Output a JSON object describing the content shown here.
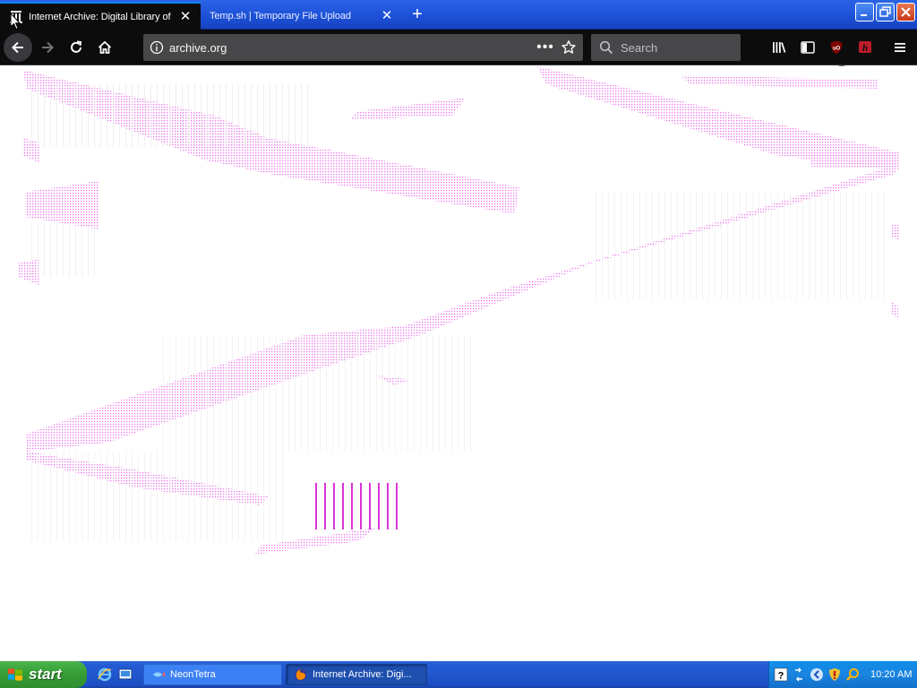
{
  "window": {
    "tabs": [
      {
        "title": "Internet Archive: Digital Library of",
        "active": true
      },
      {
        "title": "Temp.sh | Temporary File Upload",
        "active": false
      }
    ],
    "new_tab_symbol": "+",
    "close_symbol": "✕"
  },
  "navbar": {
    "url": "archive.org",
    "page_actions_symbol": "•••",
    "search_placeholder": "Search",
    "ublock_badge": "4"
  },
  "taskbar": {
    "start_label": "start",
    "tasks": [
      {
        "label": "NeonTetra",
        "active": false
      },
      {
        "label": "Internet Archive: Digi...",
        "active": true
      }
    ],
    "clock": "10:20 AM"
  },
  "colors": {
    "glitch_magenta": "#e000e0",
    "firefox_dark": "#0c0c0d",
    "xp_blue": "#245ad4",
    "xp_green": "#37a037"
  }
}
